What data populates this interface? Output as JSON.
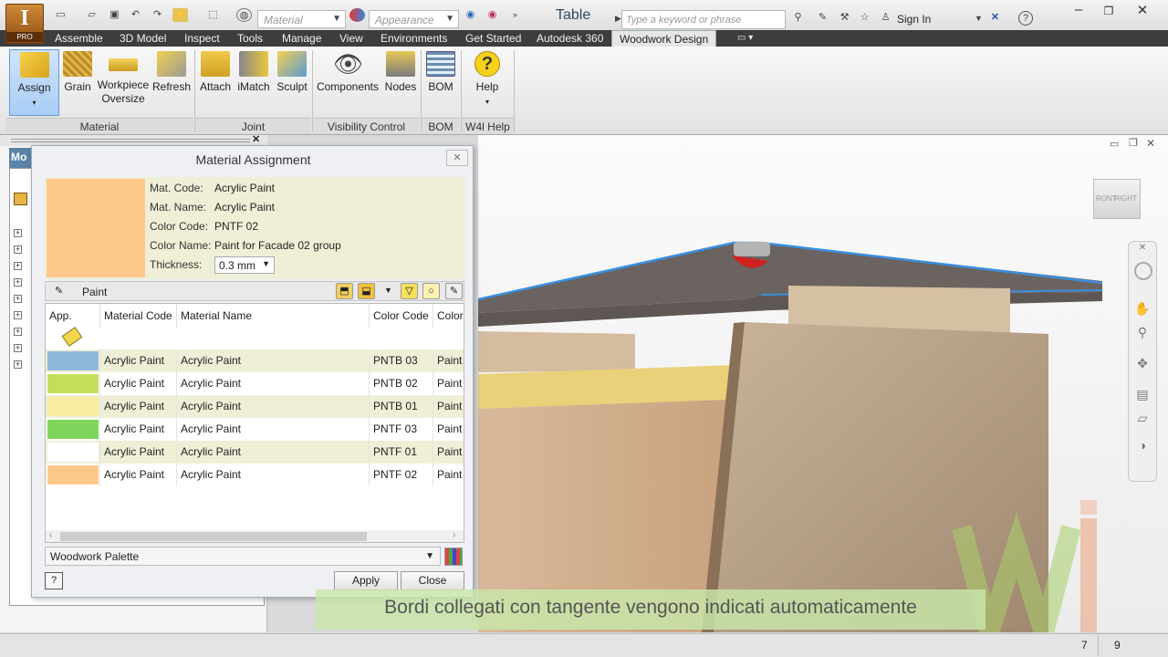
{
  "app": {
    "logo_letter": "I",
    "logo_badge": "PRO",
    "doc_title": "Table"
  },
  "qat": {
    "material_placeholder": "Material",
    "appearance_placeholder": "Appearance",
    "search_placeholder": "Type a keyword or phrase",
    "sign_in": "Sign In"
  },
  "menu": [
    "Assemble",
    "3D Model",
    "Inspect",
    "Tools",
    "Manage",
    "View",
    "Environments",
    "Get Started",
    "Autodesk 360",
    "Woodwork Design"
  ],
  "ribbon": {
    "buttons": [
      "Assign",
      "Grain",
      "Workpiece",
      "Oversize",
      "Refresh",
      "Attach",
      "iMatch",
      "Sculpt",
      "Components",
      "Nodes",
      "BOM",
      "Help"
    ],
    "panels": [
      "Material",
      "Joint",
      "Visibility Control",
      "BOM",
      "W4l Help"
    ]
  },
  "left_pane": {
    "header": "Mo"
  },
  "dialog": {
    "title": "Material Assignment",
    "close": "✕",
    "swatch_color": "#fdc98a",
    "fields": [
      {
        "label": "Mat. Code:",
        "value": "Acrylic Paint"
      },
      {
        "label": "Mat. Name:",
        "value": "Acrylic Paint"
      },
      {
        "label": "Color Code:",
        "value": "PNTF 02"
      },
      {
        "label": "Color Name:",
        "value": "Paint for Facade 02 group"
      }
    ],
    "thickness_label": "Thickness:",
    "thickness_value": "0.3 mm",
    "palette_group": "Paint",
    "columns": [
      "App.",
      "Material Code",
      "Material Name",
      "Color Code",
      "Color"
    ],
    "rows": [
      {
        "color": "#8fb8d8",
        "code": "Acrylic Paint",
        "name": "Acrylic Paint",
        "color_code": "PNTB 03",
        "color_name": "Paint"
      },
      {
        "color": "#c3de5a",
        "code": "Acrylic Paint",
        "name": "Acrylic Paint",
        "color_code": "PNTB 02",
        "color_name": "Paint"
      },
      {
        "color": "#f8ec9e",
        "code": "Acrylic Paint",
        "name": "Acrylic Paint",
        "color_code": "PNTB 01",
        "color_name": "Paint"
      },
      {
        "color": "#7fd65c",
        "code": "Acrylic Paint",
        "name": "Acrylic Paint",
        "color_code": "PNTF 03",
        "color_name": "Paint"
      },
      {
        "color": "#ffffff",
        "code": "Acrylic Paint",
        "name": "Acrylic Paint",
        "color_code": "PNTF 01",
        "color_name": "Paint"
      },
      {
        "color": "#fdc98a",
        "code": "Acrylic Paint",
        "name": "Acrylic Paint",
        "color_code": "PNTF 02",
        "color_name": "Paint"
      }
    ],
    "palette": "Woodwork Palette",
    "help": "?",
    "apply": "Apply",
    "close_button": "Close"
  },
  "viewcube": {
    "left": "RONT",
    "right": "RIGHT"
  },
  "caption": "Bordi collegati con tangente vengono indicati automaticamente",
  "status": {
    "count1": "7",
    "count2": "9"
  }
}
